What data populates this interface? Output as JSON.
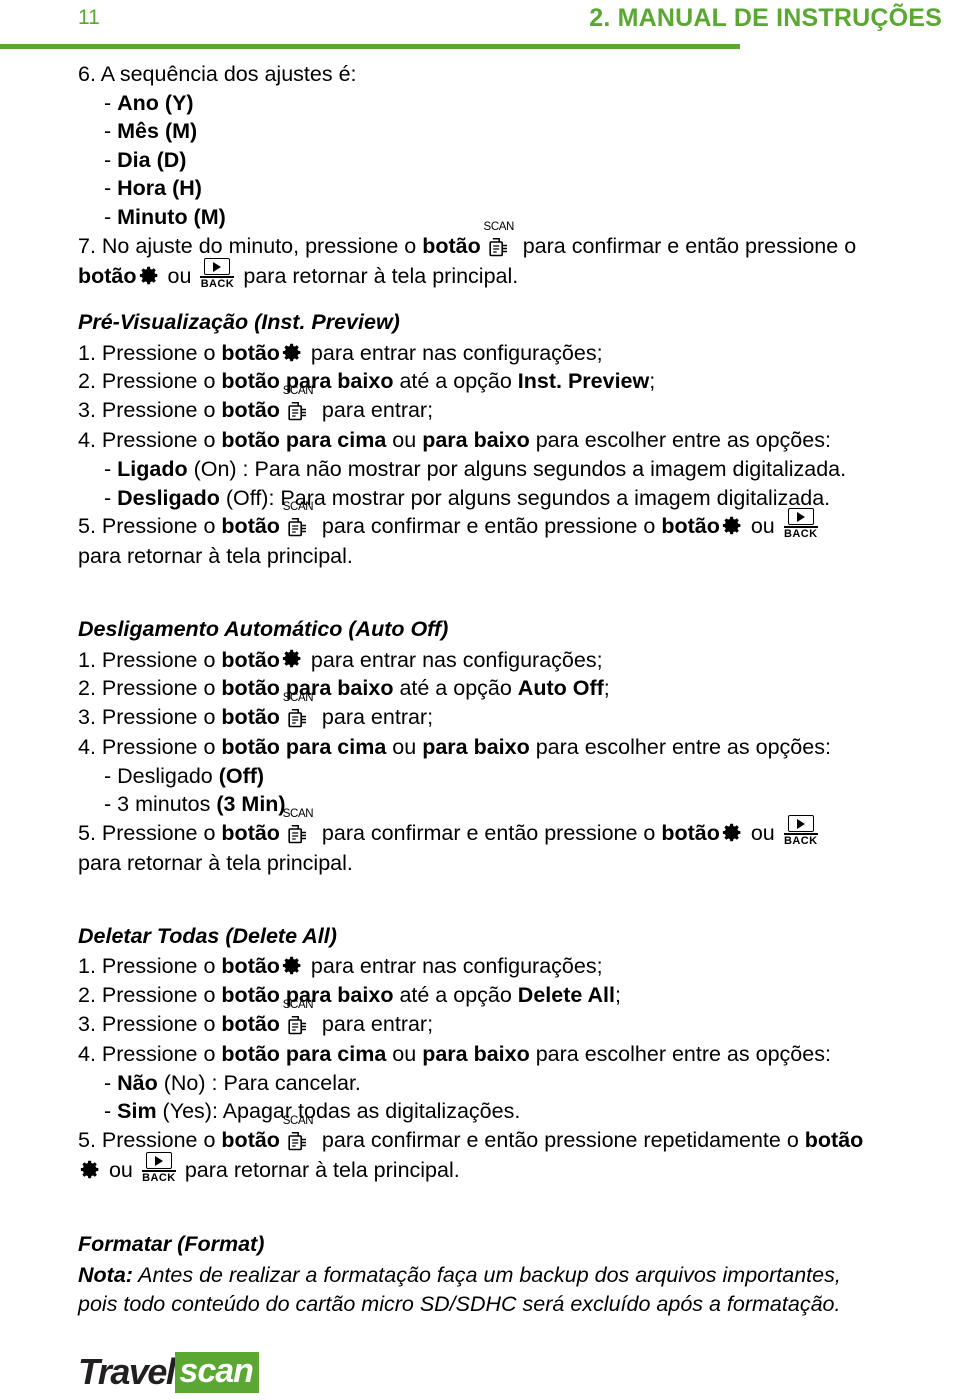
{
  "header": {
    "page_number": "11",
    "title": "2. MANUAL DE INSTRUÇÕES",
    "accent_color": "#5aa832"
  },
  "body": {
    "item6_intro": "6. A sequência dos ajustes é:",
    "item6_list": [
      {
        "dash": "- ",
        "bold": "Ano (Y)",
        "rest": ""
      },
      {
        "dash": "- ",
        "bold": "Mês (M)",
        "rest": ""
      },
      {
        "dash": "- ",
        "bold": "Dia (D)",
        "rest": ""
      },
      {
        "dash": "- ",
        "bold": "Hora (H)",
        "rest": ""
      },
      {
        "dash": "- ",
        "bold": "Minuto (M)",
        "rest": ""
      }
    ],
    "item7_a": "7. No ajuste do minuto, pressione o ",
    "item7_botao": "botão",
    "item7_b": " para confirmar e então pressione o",
    "item7_c": "botão",
    "item7_ou": " ou ",
    "item7_d": " para retornar à tela principal."
  },
  "sections": [
    {
      "title": "Pré-Visualização (Inst. Preview)",
      "lines": [
        {
          "num": "1.",
          "pre": " Pressione o ",
          "bold1": "botão",
          "mid": " para entrar nas configurações;",
          "icon": "gear",
          "icon_pos": "after_bold1"
        },
        {
          "num": "2.",
          "pre": " Pressione o ",
          "bold1": "botão para baixo",
          "mid": " até a opção ",
          "bold2": "Inst. Preview",
          "post": ";"
        },
        {
          "num": "3.",
          "pre": " Pressione o ",
          "bold1": "botão",
          "mid": " para entrar;",
          "icon": "scan",
          "icon_pos": "after_bold1"
        },
        {
          "num": "4.",
          "pre": " Pressione o ",
          "bold1": "botão para cima",
          "mid": " ou ",
          "bold2": "para baixo",
          "post": " para escolher entre as opções:"
        }
      ],
      "options": [
        {
          "dash": "- ",
          "bold": "Ligado",
          "rest": " (On) : Para não mostrar por alguns segundos a imagem digitalizada."
        },
        {
          "dash": "- ",
          "bold": "Desligado",
          "rest": " (Off): Para mostrar por alguns segundos a imagem digitalizada."
        }
      ],
      "final": {
        "num": "5.",
        "pre": " Pressione o ",
        "botao1": "botão",
        "mid": " para confirmar e então pressione o ",
        "botao2": "botão",
        "ou": " ou ",
        "last": "para retornar à tela principal."
      }
    },
    {
      "title": "Desligamento Automático (Auto Off)",
      "lines": [
        {
          "num": "1.",
          "pre": " Pressione o ",
          "bold1": "botão",
          "mid": " para entrar nas configurações;",
          "icon": "gear",
          "icon_pos": "after_bold1"
        },
        {
          "num": "2.",
          "pre": " Pressione o ",
          "bold1": "botão para baixo",
          "mid": " até a opção ",
          "bold2": "Auto Off",
          "post": ";"
        },
        {
          "num": "3.",
          "pre": " Pressione o ",
          "bold1": "botão",
          "mid": " para entrar;",
          "icon": "scan",
          "icon_pos": "after_bold1"
        },
        {
          "num": "4.",
          "pre": " Pressione o ",
          "bold1": "botão para cima",
          "mid": " ou ",
          "bold2": "para baixo",
          "post": " para escolher entre as opções:"
        }
      ],
      "options": [
        {
          "dash": "- ",
          "plain": "Desligado ",
          "bold": "(Off)",
          "rest": ""
        },
        {
          "dash": "- ",
          "plain": "3 minutos ",
          "bold": "(3 Min)",
          "rest": ""
        }
      ],
      "final": {
        "num": "5.",
        "pre": " Pressione o ",
        "botao1": "botão",
        "mid": " para confirmar e então pressione o ",
        "botao2": "botão",
        "ou": " ou ",
        "last": "para retornar à tela principal."
      }
    },
    {
      "title": "Deletar Todas (Delete All)",
      "lines": [
        {
          "num": "1.",
          "pre": " Pressione o ",
          "bold1": "botão",
          "mid": " para entrar nas configurações;",
          "icon": "gear",
          "icon_pos": "after_bold1"
        },
        {
          "num": "2.",
          "pre": " Pressione o ",
          "bold1": "botão para baixo",
          "mid": " até a opção ",
          "bold2": "Delete All",
          "post": ";"
        },
        {
          "num": "3.",
          "pre": " Pressione o ",
          "bold1": "botão",
          "mid": " para entrar;",
          "icon": "scan",
          "icon_pos": "after_bold1"
        },
        {
          "num": "4.",
          "pre": " Pressione o ",
          "bold1": "botão para cima",
          "mid": " ou ",
          "bold2": "para baixo",
          "post": " para escolher entre as opções:"
        }
      ],
      "options": [
        {
          "dash": "- ",
          "bold": "Não",
          "rest": " (No) : Para cancelar."
        },
        {
          "dash": "- ",
          "bold": "Sim",
          "rest": " (Yes): Apagar todas as digitalizações."
        }
      ],
      "final_delete": {
        "num": "5.",
        "pre": " Pressione o ",
        "botao1": "botão",
        "mid": " para confirmar e então pressione repetidamente o ",
        "botao2": "botão",
        "ou": " ou ",
        "last": " para retornar à tela principal."
      }
    }
  ],
  "format_section": {
    "title": "Formatar (Format)",
    "note_bold": "Nota:",
    "note_line1": " Antes de realizar a formatação faça um backup dos arquivos importantes,",
    "note_line2": "pois todo conteúdo do cartão micro SD/SDHC será excluído após a formatação."
  },
  "footer": {
    "logo_part1": "Travel",
    "logo_part2": "scan",
    "logo_accent": "#5aa832"
  },
  "icons": {
    "gear": "gear-icon",
    "scan": "scan-icon",
    "scan_label": "SCAN",
    "back": "back-icon",
    "back_label": "BACK"
  }
}
